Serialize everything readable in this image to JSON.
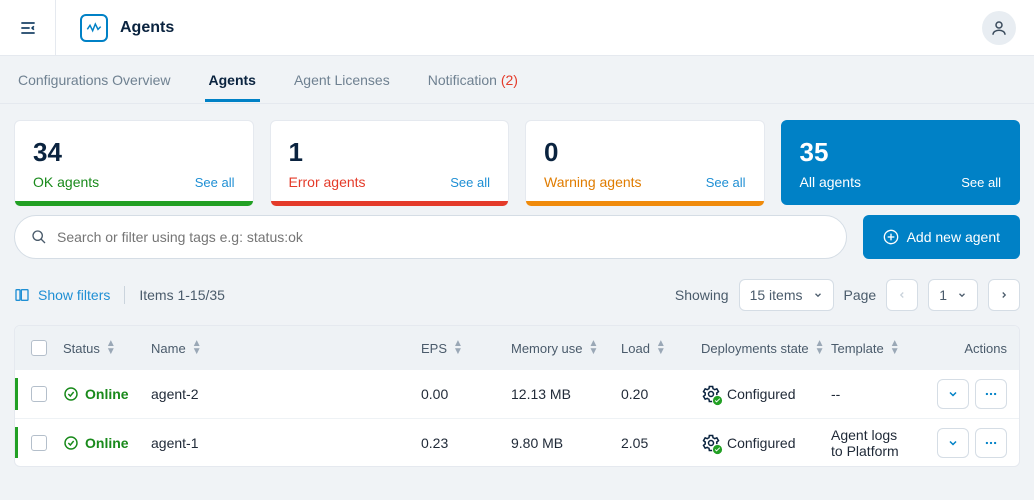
{
  "header": {
    "title": "Agents"
  },
  "tabs": {
    "configurations": "Configurations Overview",
    "agents": "Agents",
    "licenses": "Agent Licenses",
    "notification_label": "Notification",
    "notification_count": "(2)"
  },
  "cards": {
    "ok": {
      "value": "34",
      "label": "OK agents",
      "seeall": "See all"
    },
    "error": {
      "value": "1",
      "label": "Error agents",
      "seeall": "See all"
    },
    "warning": {
      "value": "0",
      "label": "Warning agents",
      "seeall": "See all"
    },
    "all": {
      "value": "35",
      "label": "All agents",
      "seeall": "See all"
    }
  },
  "search": {
    "placeholder": "Search or filter using tags e.g: status:ok"
  },
  "buttons": {
    "add": "Add new agent"
  },
  "controls": {
    "show_filters": "Show filters",
    "items_range": "Items 1-15/35",
    "showing_label": "Showing",
    "showing_value": "15 items",
    "page_label": "Page",
    "page_value": "1"
  },
  "columns": {
    "status": "Status",
    "name": "Name",
    "eps": "EPS",
    "memory": "Memory use",
    "load": "Load",
    "deployments": "Deployments state",
    "template": "Template",
    "actions": "Actions"
  },
  "rows": [
    {
      "status": "Online",
      "name": "agent-2",
      "eps": "0.00",
      "memory": "12.13 MB",
      "load": "0.20",
      "deployments": "Configured",
      "template": "--"
    },
    {
      "status": "Online",
      "name": "agent-1",
      "eps": "0.23",
      "memory": "9.80 MB",
      "load": "2.05",
      "deployments": "Configured",
      "template": "Agent logs to Platform"
    }
  ]
}
